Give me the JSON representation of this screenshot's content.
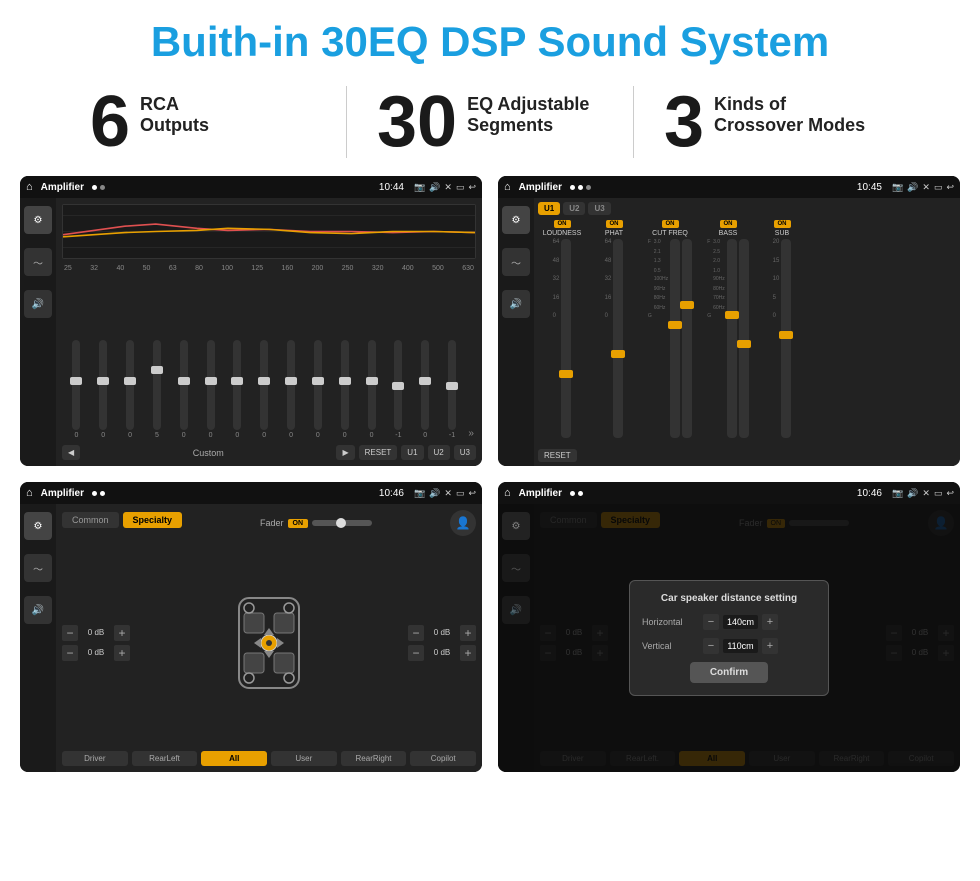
{
  "header": {
    "title": "Buith-in 30EQ DSP Sound System"
  },
  "stats": [
    {
      "num": "6",
      "line1": "RCA",
      "line2": "Outputs"
    },
    {
      "num": "30",
      "line1": "EQ Adjustable",
      "line2": "Segments"
    },
    {
      "num": "3",
      "line1": "Kinds of",
      "line2": "Crossover Modes"
    }
  ],
  "screens": [
    {
      "id": "eq-screen",
      "status": {
        "app": "Amplifier",
        "time": "10:44"
      },
      "type": "eq",
      "freqs": [
        "25",
        "32",
        "40",
        "50",
        "63",
        "80",
        "100",
        "125",
        "160",
        "200",
        "250",
        "320",
        "400",
        "500",
        "630"
      ],
      "values": [
        "0",
        "0",
        "0",
        "5",
        "0",
        "0",
        "0",
        "0",
        "0",
        "0",
        "0",
        "0",
        "-1",
        "0",
        "-1"
      ],
      "preset": "Custom",
      "nav_btns": [
        "RESET",
        "U1",
        "U2",
        "U3"
      ]
    },
    {
      "id": "amp-detail-screen",
      "status": {
        "app": "Amplifier",
        "time": "10:45"
      },
      "type": "amp-detail",
      "presets": [
        "U1",
        "U2",
        "U3"
      ],
      "controls": [
        "LOUDNESS",
        "PHAT",
        "CUT FREQ",
        "BASS",
        "SUB"
      ],
      "reset_label": "RESET"
    },
    {
      "id": "crossover-screen",
      "status": {
        "app": "Amplifier",
        "time": "10:46"
      },
      "type": "crossover",
      "tabs": [
        "Common",
        "Specialty"
      ],
      "fader_label": "Fader",
      "fader_on": "ON",
      "db_controls": [
        "0 dB",
        "0 dB",
        "0 dB",
        "0 dB"
      ],
      "bottom_btns": [
        "Driver",
        "RearLeft",
        "All",
        "User",
        "RearRight",
        "Copilot"
      ]
    },
    {
      "id": "dialog-screen",
      "status": {
        "app": "Amplifier",
        "time": "10:46"
      },
      "type": "dialog",
      "tabs": [
        "Common",
        "Specialty"
      ],
      "dialog": {
        "title": "Car speaker distance setting",
        "horizontal_label": "Horizontal",
        "horizontal_val": "140cm",
        "vertical_label": "Vertical",
        "vertical_val": "110cm",
        "confirm_label": "Confirm"
      },
      "right_db": [
        "0 dB",
        "0 dB"
      ],
      "bottom_btns": [
        "Driver",
        "RearLeft.",
        "All",
        "User",
        "RearRight",
        "Copilot"
      ]
    }
  ]
}
